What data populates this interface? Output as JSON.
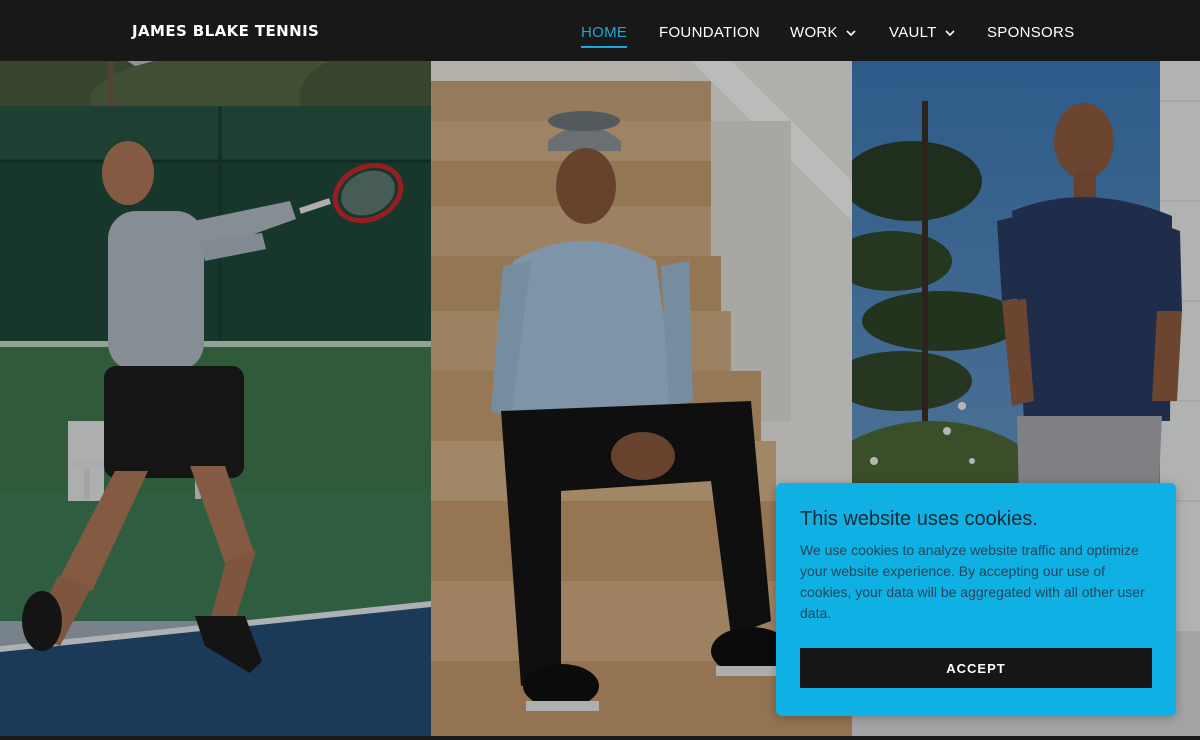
{
  "header": {
    "brand": "JAMES BLAKE TENNIS",
    "nav": [
      {
        "label": "HOME",
        "active": true,
        "dropdown": false
      },
      {
        "label": "FOUNDATION",
        "active": false,
        "dropdown": false
      },
      {
        "label": "WORK",
        "active": false,
        "dropdown": true
      },
      {
        "label": "VAULT",
        "active": false,
        "dropdown": true
      },
      {
        "label": "SPONSORS",
        "active": false,
        "dropdown": false
      }
    ]
  },
  "hero": {
    "photos": [
      {
        "subject": "tennis-forehand-photo"
      },
      {
        "subject": "seated-on-steps-photo"
      },
      {
        "subject": "standing-by-wall-photo"
      }
    ]
  },
  "cookie_banner": {
    "title": "This website uses cookies.",
    "text": "We use cookies to analyze website traffic and optimize your website experience. By accepting our use of cookies, your data will be aggregated with all other user data.",
    "accept_label": "ACCEPT"
  },
  "colors": {
    "header_bg": "#181818",
    "accent": "#1ea7df",
    "cookie_bg": "#0fb1e4",
    "button_bg": "#161616"
  },
  "icons": {
    "dropdown": "chevron-down-icon"
  }
}
